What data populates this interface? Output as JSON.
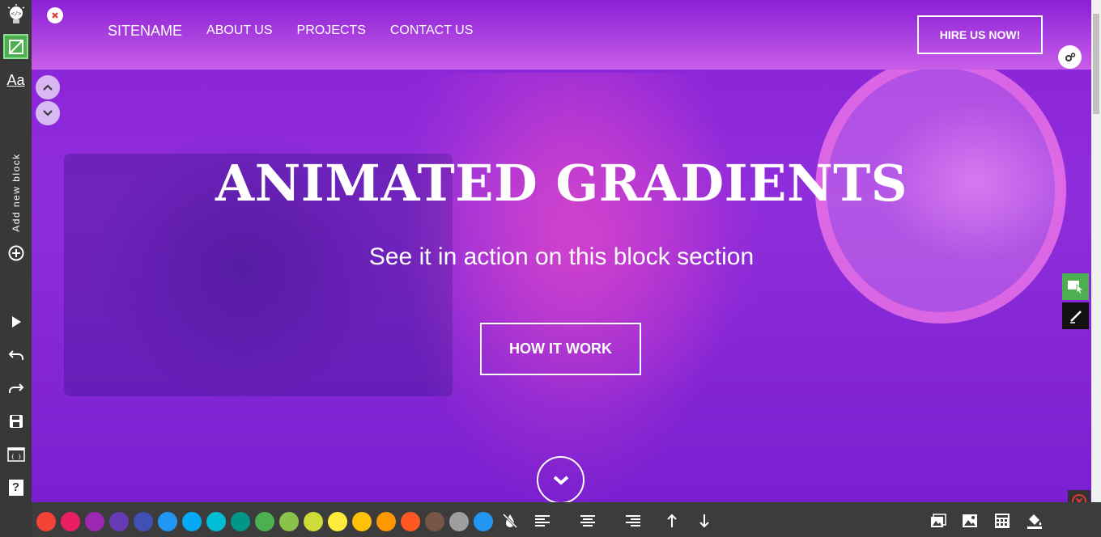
{
  "sidebar": {
    "add_block_label": "Add new block",
    "help_label": "?"
  },
  "header": {
    "nav": {
      "sitename": "SITENAME",
      "about": "ABOUT US",
      "projects": "PROJECTS",
      "contact": "CONTACT US"
    },
    "hire_button": "HIRE US NOW!"
  },
  "hero": {
    "title": "ANIMATED GRADIENTS",
    "subtitle": "See it in action on this block section",
    "cta": "HOW IT WORK"
  },
  "toolbar": {
    "swatches": [
      "#f44336",
      "#e91e63",
      "#9c27b0",
      "#673ab7",
      "#3f51b5",
      "#2196f3",
      "#03a9f4",
      "#00bcd4",
      "#009688",
      "#4caf50",
      "#8bc34a",
      "#cddc39",
      "#ffeb3b",
      "#ffc107",
      "#ff9800",
      "#ff5722",
      "#795548",
      "#9e9e9e",
      "#2196f3"
    ]
  },
  "colors": {
    "accent_green": "#4caf50",
    "sidebar_bg": "#383838",
    "toolbar_bg": "#3c3c3c",
    "hero_purple": "#8a22d8"
  }
}
